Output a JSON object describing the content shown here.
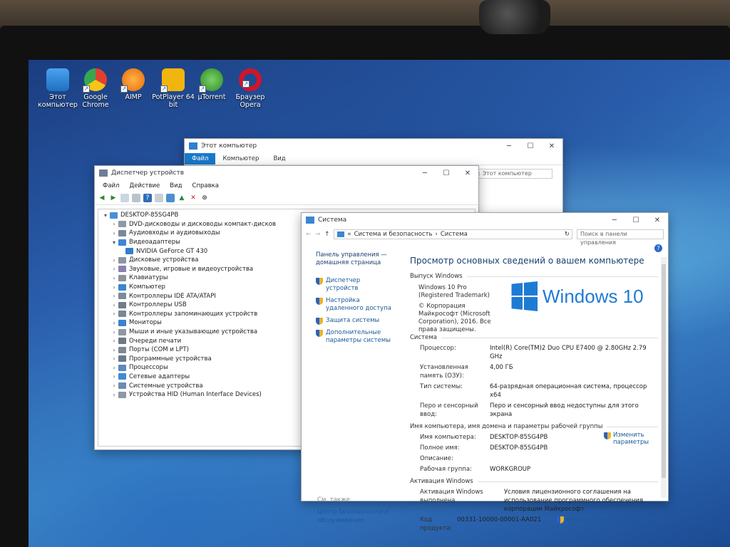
{
  "desktop": {
    "icons": [
      {
        "label": "Этот компьютер",
        "color": "#2e7fd1"
      },
      {
        "label": "Google Chrome",
        "color": "#e0412f"
      },
      {
        "label": "AIMP",
        "color": "#f07c0d"
      },
      {
        "label": "PotPlayer 64 bit",
        "color": "#f2b50f"
      },
      {
        "label": "µTorrent",
        "color": "#4aa83a"
      },
      {
        "label": "Браузер Opera",
        "color": "#d0152a"
      }
    ]
  },
  "explorer": {
    "title": "Этот компьютер",
    "tabs": [
      "Файл",
      "Компьютер",
      "Вид"
    ],
    "search_placeholder": "ск: Этот компьютер"
  },
  "devmgr": {
    "title": "Диспетчер устройств",
    "menu": [
      "Файл",
      "Действие",
      "Вид",
      "Справка"
    ],
    "root": "DESKTOP-85SG4PB",
    "items": [
      {
        "label": "DVD-дисководы и дисководы компакт-дисков",
        "expanded": false
      },
      {
        "label": "Аудиовходы и аудиовыходы",
        "expanded": false
      },
      {
        "label": "Видеоадаптеры",
        "expanded": true
      },
      {
        "label": "NVIDIA GeForce GT 430",
        "child": true
      },
      {
        "label": "Дисковые устройства",
        "expanded": false
      },
      {
        "label": "Звуковые, игровые и видеоустройства",
        "expanded": false
      },
      {
        "label": "Клавиатуры",
        "expanded": false
      },
      {
        "label": "Компьютер",
        "expanded": false
      },
      {
        "label": "Контроллеры IDE ATA/ATAPI",
        "expanded": false
      },
      {
        "label": "Контроллеры USB",
        "expanded": false
      },
      {
        "label": "Контроллеры запоминающих устройств",
        "expanded": false
      },
      {
        "label": "Мониторы",
        "expanded": false
      },
      {
        "label": "Мыши и иные указывающие устройства",
        "expanded": false
      },
      {
        "label": "Очереди печати",
        "expanded": false
      },
      {
        "label": "Порты (COM и LPT)",
        "expanded": false
      },
      {
        "label": "Программные устройства",
        "expanded": false
      },
      {
        "label": "Процессоры",
        "expanded": false
      },
      {
        "label": "Сетевые адаптеры",
        "expanded": false
      },
      {
        "label": "Системные устройства",
        "expanded": false
      },
      {
        "label": "Устройства HID (Human Interface Devices)",
        "expanded": false
      }
    ]
  },
  "system": {
    "title": "Система",
    "breadcrumb": [
      "Система и безопасность",
      "Система"
    ],
    "search_placeholder": "Поиск в панели управления",
    "left": {
      "home": "Панель управления — домашняя страница",
      "links": [
        "Диспетчер устройств",
        "Настройка удаленного доступа",
        "Защита системы",
        "Дополнительные параметры системы"
      ],
      "see_also": "См. также",
      "security": "Центр безопасности и обслуживания"
    },
    "heading": "Просмотр основных сведений о вашем компьютере",
    "edition_section": "Выпуск Windows",
    "edition": "Windows 10 Pro (Registered Trademark)",
    "copyright": "© Корпорация Майкрософт (Microsoft Corporation), 2016. Все права защищены.",
    "logo_text": "Windows 10",
    "system_section": "Система",
    "processor_label": "Процессор:",
    "processor": "Intel(R) Core(TM)2 Duo CPU     E7400  @ 2.80GHz   2.79 GHz",
    "ram_label": "Установленная память (ОЗУ):",
    "ram": "4,00 ГБ",
    "type_label": "Тип системы:",
    "type": "64-разрядная операционная система, процессор x64",
    "pen_label": "Перо и сенсорный ввод:",
    "pen": "Перо и сенсорный ввод недоступны для этого экрана",
    "name_section": "Имя компьютера, имя домена и параметры рабочей группы",
    "computer_name_label": "Имя компьютера:",
    "computer_name": "DESKTOP-85SG4PB",
    "full_name_label": "Полное имя:",
    "full_name": "DESKTOP-85SG4PB",
    "description_label": "Описание:",
    "workgroup_label": "Рабочая группа:",
    "workgroup": "WORKGROUP",
    "change_params": "Изменить параметры",
    "activation_section": "Активация Windows",
    "activation_status": "Активация Windows выполнена",
    "license_link": "Условия лицензионного соглашения на использование программного обеспечения корпорации Майкрософт",
    "product_id_label": "Код продукта:",
    "product_id": "00331-10000-00001-AA021",
    "change_key": "Изменить ключ продукта"
  }
}
